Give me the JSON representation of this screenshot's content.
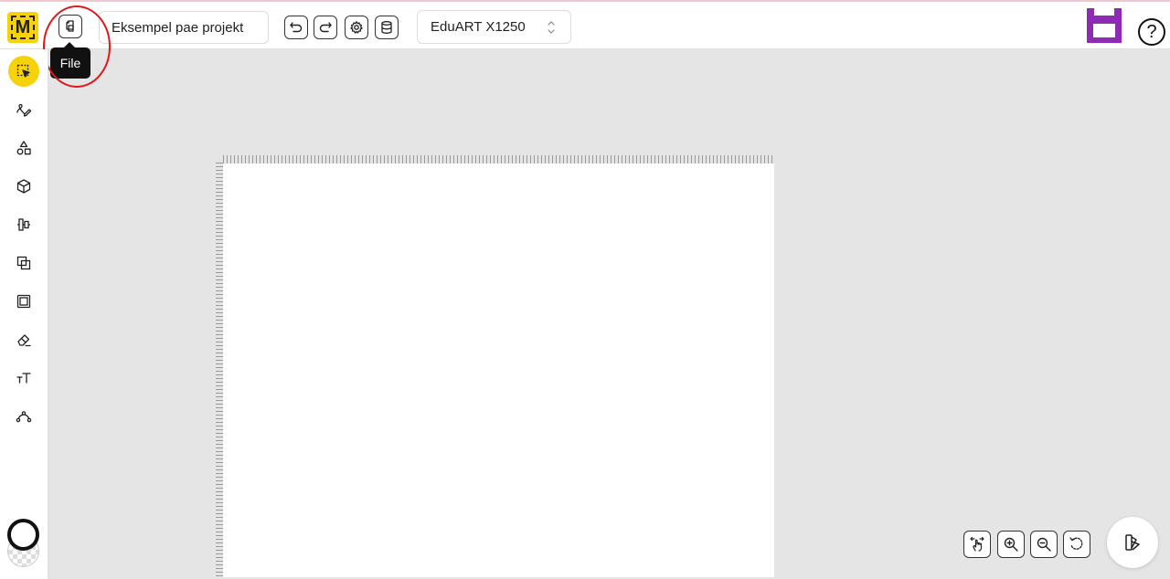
{
  "app": {
    "logo_letter": "M",
    "accent_color": "#f5d20a",
    "save_color": "#8e2bb5"
  },
  "toolbar": {
    "file_tooltip": "File",
    "project_name": "Eksempel pae projekt",
    "machine": "EduART X1250",
    "help_symbol": "?",
    "buttons": [
      "file-icon",
      "undo-icon",
      "redo-icon",
      "settings-gear-icon",
      "material-database-icon",
      "save-icon",
      "help-icon"
    ]
  },
  "sidebar": {
    "active_tool": "select-icon",
    "tools": [
      "select-icon",
      "pen-draw-icon",
      "shapes-icon",
      "3d-cube-icon",
      "align-icon",
      "combine-icon",
      "frame-icon",
      "eraser-icon",
      "text-icon",
      "node-edit-icon"
    ],
    "stroke_color": "#111111",
    "fill_color": "transparent"
  },
  "view_controls": {
    "buttons": [
      "pan-hand-icon",
      "zoom-in-icon",
      "zoom-out-icon",
      "reset-view-icon",
      "material-swatch-icon"
    ]
  }
}
